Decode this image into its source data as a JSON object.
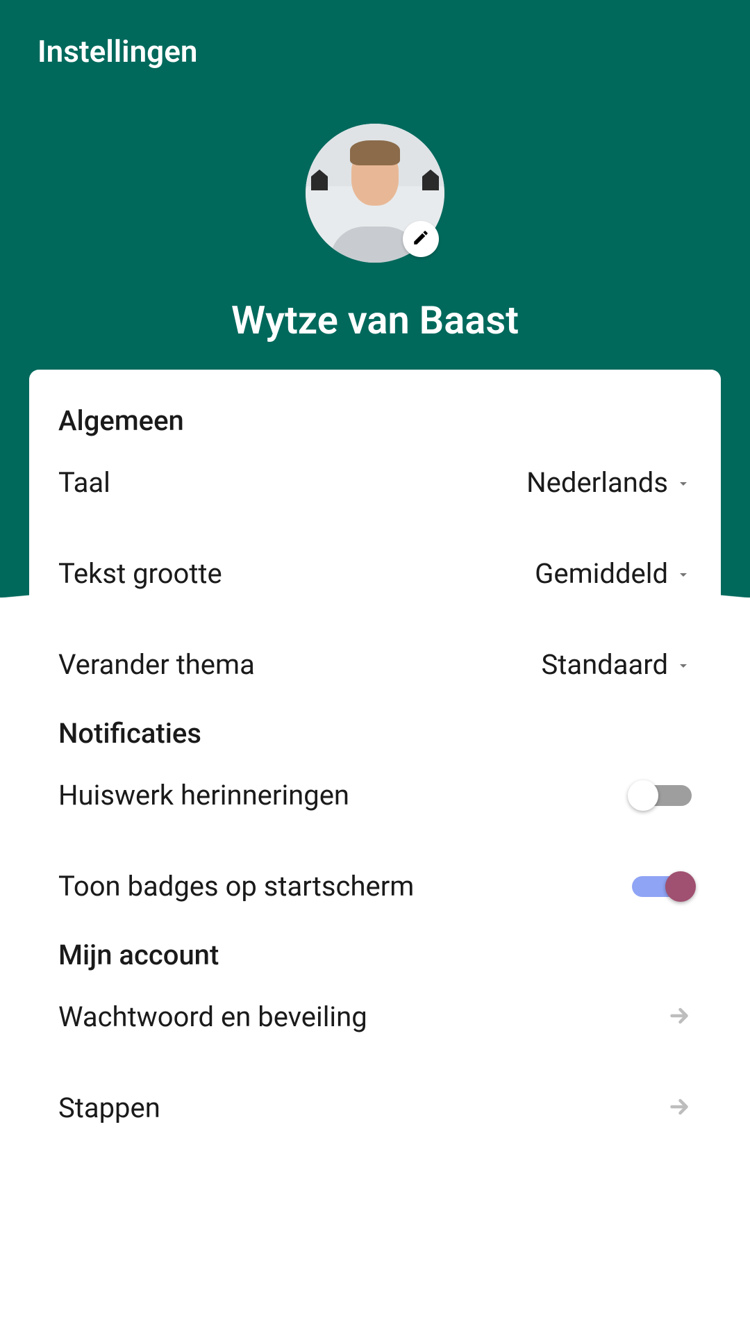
{
  "header": {
    "title": "Instellingen"
  },
  "profile": {
    "name": "Wytze van Baast"
  },
  "sections": {
    "general": {
      "title": "Algemeen",
      "language": {
        "label": "Taal",
        "value": "Nederlands"
      },
      "textSize": {
        "label": "Tekst grootte",
        "value": "Gemiddeld"
      },
      "theme": {
        "label": "Verander thema",
        "value": "Standaard"
      }
    },
    "notifications": {
      "title": "Notificaties",
      "homework": {
        "label": "Huiswerk herinneringen",
        "enabled": false
      },
      "badges": {
        "label": "Toon badges op startscherm",
        "enabled": true
      }
    },
    "account": {
      "title": "Mijn account",
      "password": {
        "label": "Wachtwoord en beveiling"
      },
      "steps": {
        "label": "Stappen"
      }
    }
  }
}
